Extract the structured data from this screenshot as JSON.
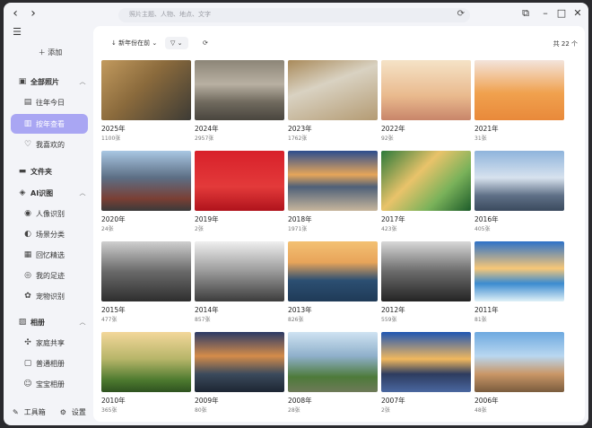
{
  "search": {
    "placeholder": "照片主题、人物、地点、文字"
  },
  "sidebar": {
    "add_label": "添加",
    "groups": [
      {
        "header": "全部照片",
        "items": [
          "往年今日",
          "按年查看",
          "我喜欢的"
        ]
      },
      {
        "header": "文件夹",
        "items": []
      },
      {
        "header": "AI识图",
        "items": [
          "人像识别",
          "场景分类",
          "回忆精选",
          "我的足迹",
          "宠物识别"
        ]
      },
      {
        "header": "相册",
        "items": [
          "家庭共享",
          "普通相册",
          "宝宝相册"
        ]
      }
    ],
    "active_item": "按年查看",
    "tools_label": "工具箱",
    "settings_label": "设置"
  },
  "toolbar": {
    "sort_label": "新年份在前",
    "count_label": "共 22 个"
  },
  "years": [
    {
      "year": "2025年",
      "count": "1100张"
    },
    {
      "year": "2024年",
      "count": "2957张"
    },
    {
      "year": "2023年",
      "count": "1762张"
    },
    {
      "year": "2022年",
      "count": "92张"
    },
    {
      "year": "2021年",
      "count": "31张"
    },
    {
      "year": "2020年",
      "count": "24张"
    },
    {
      "year": "2019年",
      "count": "2张"
    },
    {
      "year": "2018年",
      "count": "1971张"
    },
    {
      "year": "2017年",
      "count": "423张"
    },
    {
      "year": "2016年",
      "count": "405张"
    },
    {
      "year": "2015年",
      "count": "477张"
    },
    {
      "year": "2014年",
      "count": "857张"
    },
    {
      "year": "2013年",
      "count": "826张"
    },
    {
      "year": "2012年",
      "count": "559张"
    },
    {
      "year": "2011年",
      "count": "81张"
    },
    {
      "year": "2010年",
      "count": "365张"
    },
    {
      "year": "2009年",
      "count": "80张"
    },
    {
      "year": "2008年",
      "count": "28张"
    },
    {
      "year": "2007年",
      "count": "2张"
    },
    {
      "year": "2006年",
      "count": "48张"
    }
  ],
  "icons": {
    "back": "chevron-left-icon",
    "forward": "chevron-right-icon",
    "menu": "menu-icon",
    "search_refresh": "refresh-icon",
    "filter": "filter-icon",
    "sort": "sort-icon"
  }
}
